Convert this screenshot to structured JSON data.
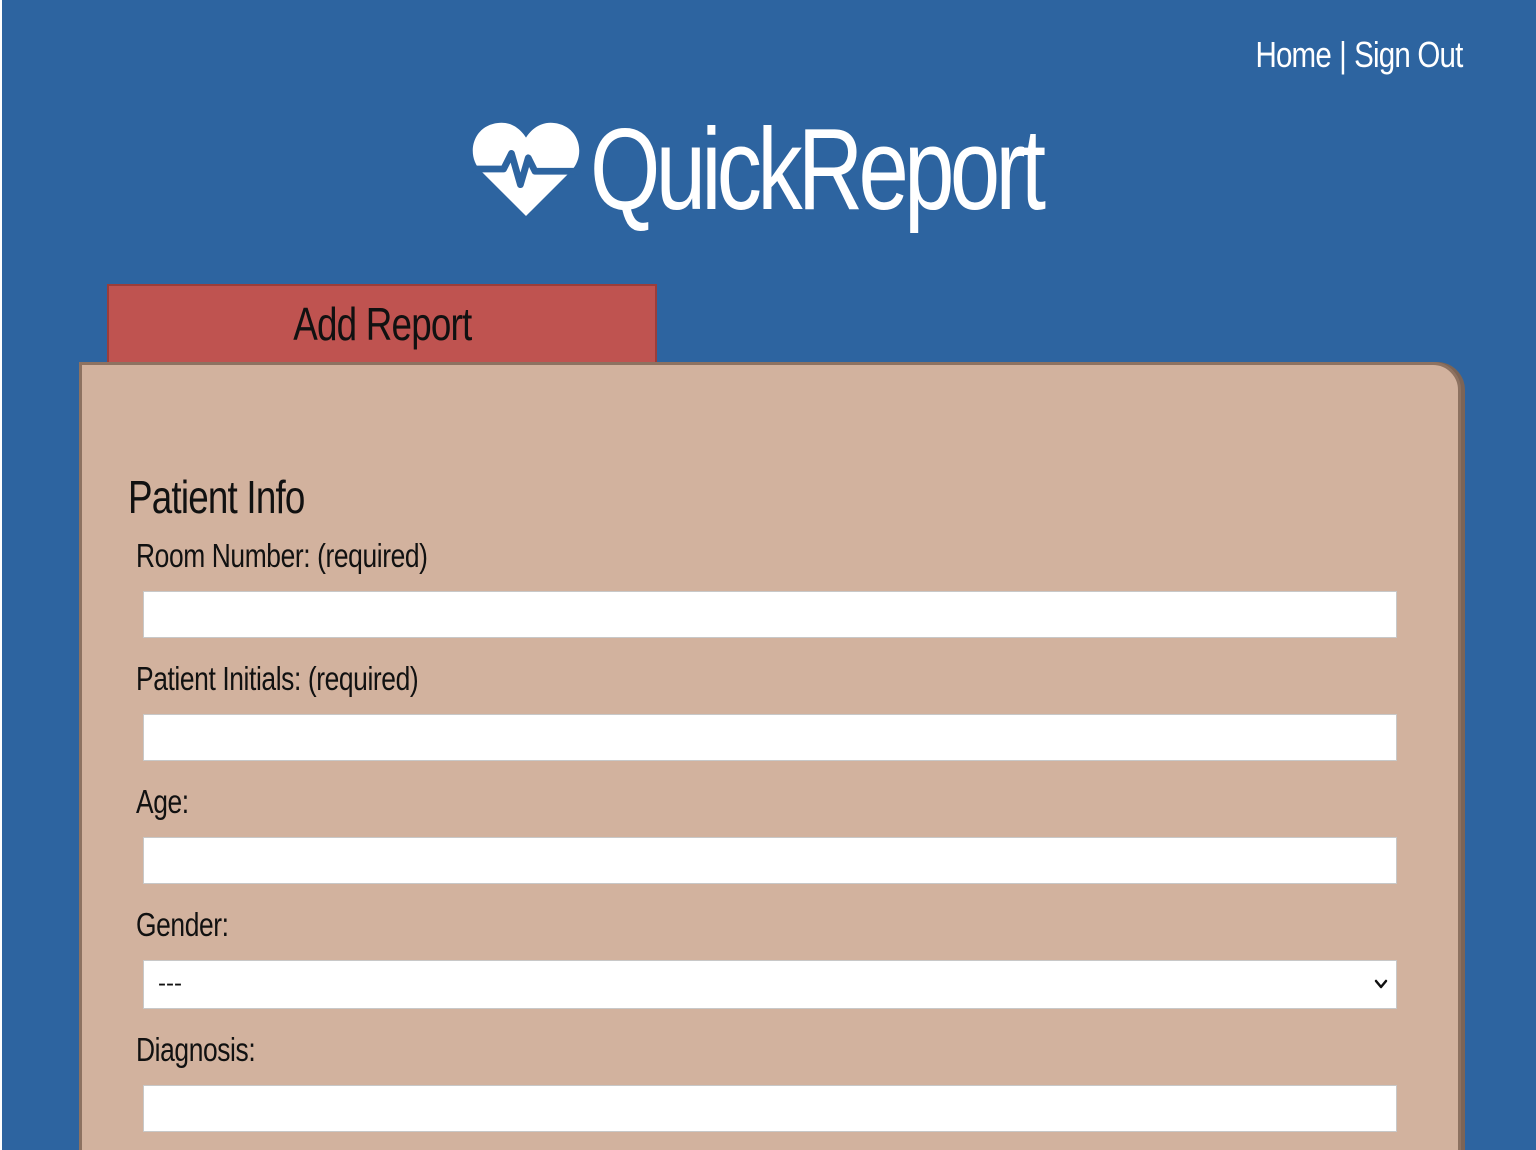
{
  "nav": {
    "home": "Home",
    "separator": "|",
    "sign_out": "Sign Out"
  },
  "brand": {
    "name": "QuickReport",
    "icon": "heart-pulse-icon"
  },
  "tab": {
    "label": "Add Report"
  },
  "form": {
    "section_title": "Patient Info",
    "room_number": {
      "label": "Room Number: (required)",
      "value": ""
    },
    "patient_initials": {
      "label": "Patient Initials: (required)",
      "value": ""
    },
    "age": {
      "label": "Age:",
      "value": ""
    },
    "gender": {
      "label": "Gender:",
      "selected": "---"
    },
    "diagnosis": {
      "label": "Diagnosis:",
      "value": ""
    }
  },
  "colors": {
    "background": "#2d64a0",
    "tab": "#bf5350",
    "card": "#d2b29e",
    "text_light": "#ffffff",
    "text_dark": "#111111"
  }
}
